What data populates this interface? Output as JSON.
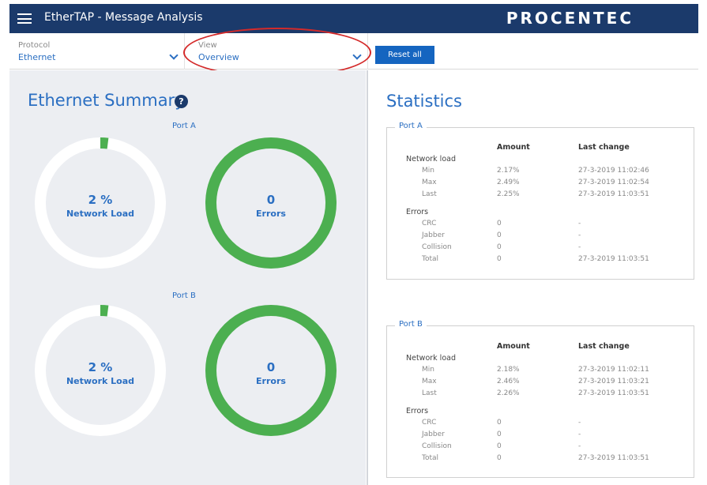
{
  "header": {
    "title": "EtherTAP - Message Analysis",
    "brand": "PROCENTEC"
  },
  "selectors": {
    "protocol": {
      "label": "Protocol",
      "value": "Ethernet"
    },
    "view": {
      "label": "View",
      "value": "Overview"
    },
    "reset_label": "Reset all"
  },
  "summary": {
    "title": "Ethernet Summary",
    "help_icon": "?",
    "ports": [
      {
        "label": "Port A",
        "load_value": "2 %",
        "load_caption": "Network Load",
        "load_fraction": 0.02,
        "errors_value": "0",
        "errors_caption": "Errors"
      },
      {
        "label": "Port B",
        "load_value": "2 %",
        "load_caption": "Network Load",
        "load_fraction": 0.02,
        "errors_value": "0",
        "errors_caption": "Errors"
      }
    ]
  },
  "statistics": {
    "title": "Statistics",
    "col_amount": "Amount",
    "col_last_change": "Last change",
    "group_network": "Network load",
    "group_errors": "Errors",
    "ports": [
      {
        "label": "Port A",
        "network": [
          {
            "name": "Min",
            "amount": "2.17%",
            "last": "27-3-2019 11:02:46"
          },
          {
            "name": "Max",
            "amount": "2.49%",
            "last": "27-3-2019 11:02:54"
          },
          {
            "name": "Last",
            "amount": "2.25%",
            "last": "27-3-2019 11:03:51"
          }
        ],
        "errors": [
          {
            "name": "CRC",
            "amount": "0",
            "last": "-"
          },
          {
            "name": "Jabber",
            "amount": "0",
            "last": "-"
          },
          {
            "name": "Collision",
            "amount": "0",
            "last": "-"
          },
          {
            "name": "Total",
            "amount": "0",
            "last": "27-3-2019 11:03:51"
          }
        ]
      },
      {
        "label": "Port B",
        "network": [
          {
            "name": "Min",
            "amount": "2.18%",
            "last": "27-3-2019 11:02:11"
          },
          {
            "name": "Max",
            "amount": "2.46%",
            "last": "27-3-2019 11:03:21"
          },
          {
            "name": "Last",
            "amount": "2.26%",
            "last": "27-3-2019 11:03:51"
          }
        ],
        "errors": [
          {
            "name": "CRC",
            "amount": "0",
            "last": "-"
          },
          {
            "name": "Jabber",
            "amount": "0",
            "last": "-"
          },
          {
            "name": "Collision",
            "amount": "0",
            "last": "-"
          },
          {
            "name": "Total",
            "amount": "0",
            "last": "27-3-2019 11:03:51"
          }
        ]
      }
    ]
  },
  "colors": {
    "header_bg": "#1b3a6b",
    "accent": "#2b6fc2",
    "gauge_green": "#4caf50",
    "highlight": "#d42a2a"
  }
}
